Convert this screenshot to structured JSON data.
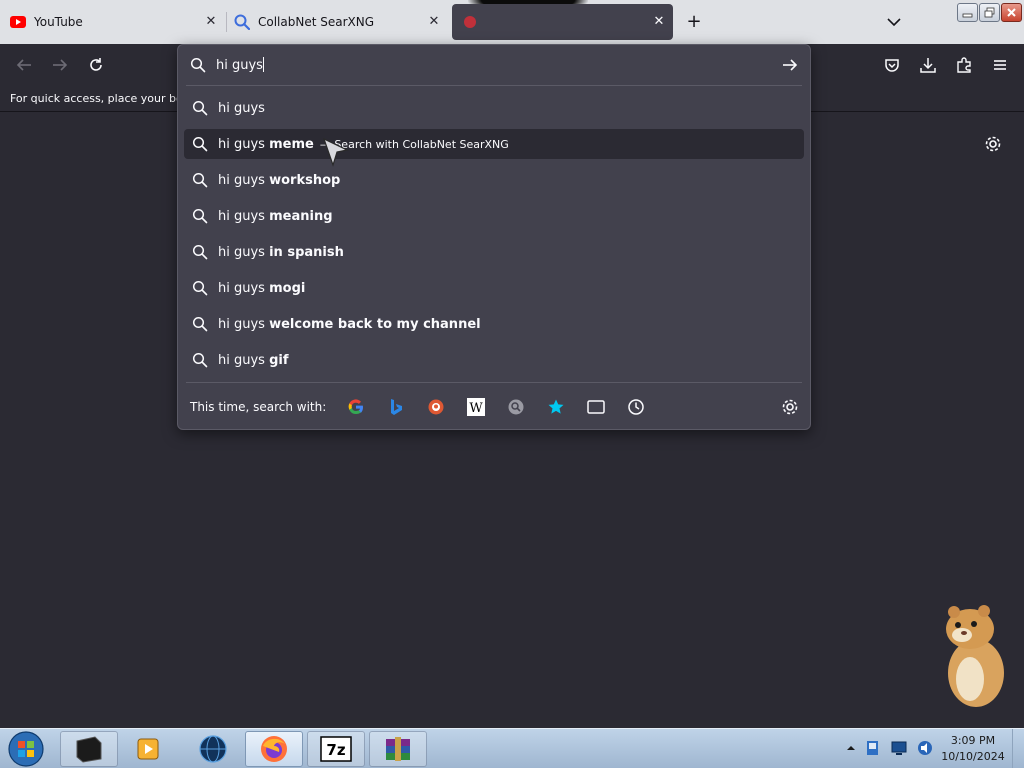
{
  "tabs": [
    {
      "title": "YouTube",
      "icon": "youtube-icon"
    },
    {
      "title": "CollabNet SearXNG",
      "icon": "search-icon"
    },
    {
      "title": "",
      "icon": "page-icon"
    }
  ],
  "urlbar": {
    "value": "hi guys",
    "suggestions": [
      {
        "prefix": "hi guys",
        "bold": ""
      },
      {
        "prefix": "hi guys",
        "bold": "meme",
        "action": "— Search with CollabNet SearXNG",
        "selected": true
      },
      {
        "prefix": "hi guys",
        "bold": "workshop"
      },
      {
        "prefix": "hi guys",
        "bold": "meaning"
      },
      {
        "prefix": "hi guys",
        "bold": "in spanish"
      },
      {
        "prefix": "hi guys",
        "bold": "mogi"
      },
      {
        "prefix": "hi guys",
        "bold": "welcome back to my channel"
      },
      {
        "prefix": "hi guys",
        "bold": "gif"
      }
    ],
    "oneoff_label": "This time, search with:",
    "engines": [
      "google-icon",
      "bing-icon",
      "duckduckgo-icon",
      "wikipedia-icon",
      "searxng-icon",
      "bookmarks-star-icon",
      "tabs-icon",
      "history-icon"
    ]
  },
  "bookmarks_toolbar": {
    "text": "For quick access, place your boo"
  },
  "taskbar": {
    "time": "3:09 PM",
    "date": "10/10/2024"
  },
  "colors": {
    "tab_strip": "#dfe1e5",
    "toolbar": "#2b2a33",
    "panel": "#42414d",
    "text": "#fbfbfe"
  }
}
